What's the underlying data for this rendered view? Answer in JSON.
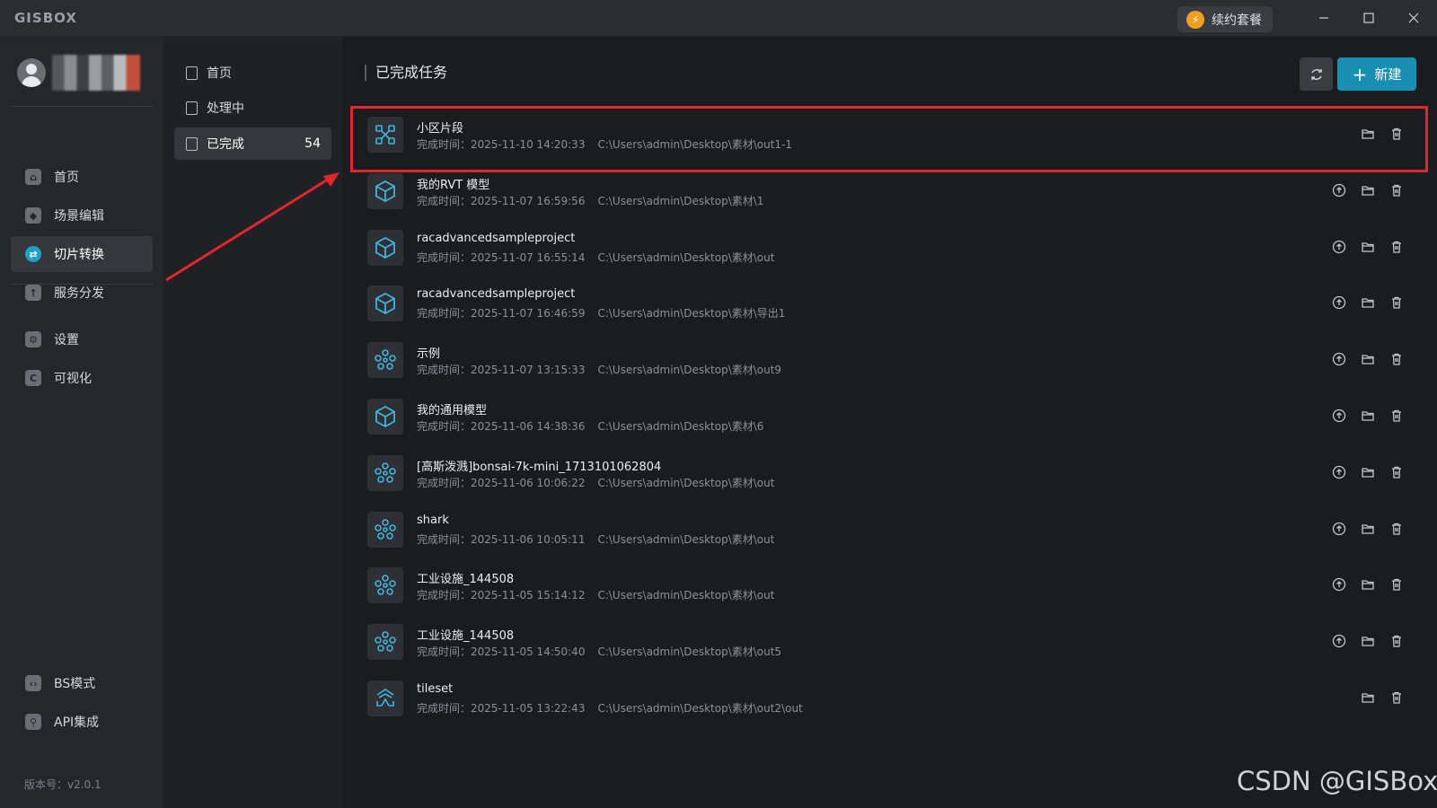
{
  "app": {
    "logo": "GISBOX",
    "renew_label": "续约套餐",
    "version": "版本号：v2.0.1"
  },
  "sidebar": {
    "items": [
      {
        "label": "首页",
        "icon": "home-icon",
        "glyph": "⌂"
      },
      {
        "label": "场景编辑",
        "icon": "cube-icon",
        "glyph": "◆"
      },
      {
        "label": "切片转换",
        "icon": "convert-icon",
        "glyph": "⇄",
        "active": true
      },
      {
        "label": "服务分发",
        "icon": "upload-icon",
        "glyph": "↑"
      },
      {
        "label": "设置",
        "icon": "gear-icon",
        "glyph": "⚙"
      },
      {
        "label": "可视化",
        "icon": "visual-icon",
        "glyph": "C"
      }
    ],
    "bottom_items": [
      {
        "label": "BS模式",
        "icon": "code-icon",
        "glyph": "‹›"
      },
      {
        "label": "API集成",
        "icon": "api-icon",
        "glyph": "⚲"
      }
    ]
  },
  "subnav": {
    "items": [
      {
        "label": "首页",
        "icon": "home-icon"
      },
      {
        "label": "处理中",
        "icon": "processing-icon"
      },
      {
        "label": "已完成",
        "icon": "done-icon",
        "count": "54",
        "active": true
      }
    ]
  },
  "main": {
    "title": "已完成任务",
    "new_label": "新建",
    "tasks": [
      {
        "name": "小区片段",
        "time": "完成时间：2025-11-10 14:20:33",
        "path": "C:\\Users\\admin\\Desktop\\素材\\out1-1",
        "icon": "mesh-icon",
        "upload": false
      },
      {
        "name": "我的RVT 模型",
        "time": "完成时间：2025-11-07 16:59:56",
        "path": "C:\\Users\\admin\\Desktop\\素材\\1",
        "icon": "model-cube-icon",
        "upload": true
      },
      {
        "name": "racadvancedsampleproject",
        "time": "完成时间：2025-11-07 16:55:14",
        "path": "C:\\Users\\admin\\Desktop\\素材\\out",
        "icon": "model-cube-icon",
        "upload": true
      },
      {
        "name": "racadvancedsampleproject",
        "time": "完成时间：2025-11-07 16:46:59",
        "path": "C:\\Users\\admin\\Desktop\\素材\\导出1",
        "icon": "model-cube-icon",
        "upload": true
      },
      {
        "name": "示例",
        "time": "完成时间：2025-11-07 13:15:33",
        "path": "C:\\Users\\admin\\Desktop\\素材\\out9",
        "icon": "point-cloud-icon",
        "upload": true
      },
      {
        "name": "我的通用模型",
        "time": "完成时间：2025-11-06 14:38:36",
        "path": "C:\\Users\\admin\\Desktop\\素材\\6",
        "icon": "model-cube-icon",
        "upload": true
      },
      {
        "name": "[高斯泼溅]bonsai-7k-mini_1713101062804",
        "time": "完成时间：2025-11-06 10:06:22",
        "path": "C:\\Users\\admin\\Desktop\\素材\\out",
        "icon": "point-cloud-icon",
        "upload": true
      },
      {
        "name": "shark",
        "time": "完成时间：2025-11-06 10:05:11",
        "path": "C:\\Users\\admin\\Desktop\\素材\\out",
        "icon": "point-cloud-icon",
        "upload": true
      },
      {
        "name": "工业设施_144508",
        "time": "完成时间：2025-11-05 15:14:12",
        "path": "C:\\Users\\admin\\Desktop\\素材\\out",
        "icon": "point-cloud-icon",
        "upload": true
      },
      {
        "name": "工业设施_144508",
        "time": "完成时间：2025-11-05 14:50:40",
        "path": "C:\\Users\\admin\\Desktop\\素材\\out5",
        "icon": "point-cloud-icon",
        "upload": true
      },
      {
        "name": "tileset",
        "time": "完成时间：2025-11-05 13:22:43",
        "path": "C:\\Users\\admin\\Desktop\\素材\\out2\\out",
        "icon": "tileset-icon",
        "upload": false
      }
    ]
  },
  "watermark": "CSDN @GISBox",
  "colors": {
    "accent": "#1a8fb4",
    "icon_blue": "#3fb6df",
    "highlight": "#e3262e"
  }
}
